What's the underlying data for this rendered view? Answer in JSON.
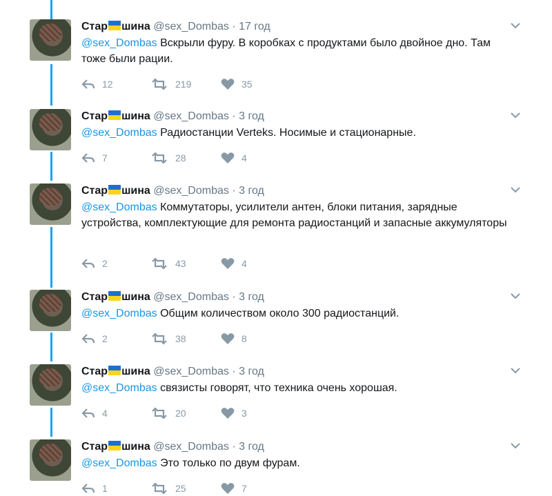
{
  "colors": {
    "thread": "#1da1f2",
    "mention": "#1b95e0",
    "muted": "#657786",
    "icon": "#8899a6"
  },
  "icons": {
    "reply": "reply-icon",
    "retweet": "retweet-icon",
    "like": "heart-icon",
    "more": "chevron-down-icon"
  },
  "tweets": [
    {
      "name_pre": "Стар",
      "name_post": "шина",
      "handle": "@sex_Dombas",
      "dot": "·",
      "time": "17 год",
      "mention": "@sex_Dombas",
      "text": "Вскрыли фуру. В коробках с продуктами было двойное дно. Там тоже были рации.",
      "replies": "12",
      "retweets": "219",
      "likes": "35"
    },
    {
      "name_pre": "Стар",
      "name_post": "шина",
      "handle": "@sex_Dombas",
      "dot": "·",
      "time": "3 год",
      "mention": "@sex_Dombas",
      "text": "Радиостанции Verteks. Носимые и стационарные.",
      "replies": "7",
      "retweets": "28",
      "likes": "4"
    },
    {
      "name_pre": "Стар",
      "name_post": "шина",
      "handle": "@sex_Dombas",
      "dot": "·",
      "time": "3 год",
      "mention": "@sex_Dombas",
      "text": "Коммутаторы, усилители антен, блоки питания, зарядные устройства, комплектующие для ремонта радиостанций и запасные аккумуляторы",
      "replies": "2",
      "retweets": "43",
      "likes": "4"
    },
    {
      "name_pre": "Стар",
      "name_post": "шина",
      "handle": "@sex_Dombas",
      "dot": "·",
      "time": "3 год",
      "mention": "@sex_Dombas",
      "text": "Общим количеством около 300 радиостанций.",
      "replies": "2",
      "retweets": "38",
      "likes": "8"
    },
    {
      "name_pre": "Стар",
      "name_post": "шина",
      "handle": "@sex_Dombas",
      "dot": "·",
      "time": "3 год",
      "mention": "@sex_Dombas",
      "text": "связисты говорят, что техника очень хорошая.",
      "replies": "4",
      "retweets": "20",
      "likes": "3"
    },
    {
      "name_pre": "Стар",
      "name_post": "шина",
      "handle": "@sex_Dombas",
      "dot": "·",
      "time": "3 год",
      "mention": "@sex_Dombas",
      "text": "Это только по двум фурам.",
      "replies": "1",
      "retweets": "25",
      "likes": "7"
    }
  ]
}
